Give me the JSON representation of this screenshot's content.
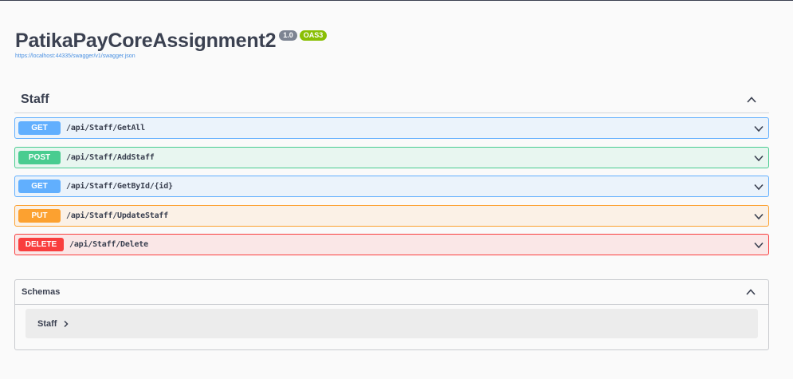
{
  "info": {
    "title": "PatikaPayCoreAssignment2",
    "version": "1.0",
    "oas": "OAS3",
    "url": "https://localhost:44335/swagger/v1/swagger.json"
  },
  "tag": {
    "name": "Staff"
  },
  "operations": [
    {
      "method": "GET",
      "path": "/api/Staff/GetAll"
    },
    {
      "method": "POST",
      "path": "/api/Staff/AddStaff"
    },
    {
      "method": "GET",
      "path": "/api/Staff/GetById/{id}"
    },
    {
      "method": "PUT",
      "path": "/api/Staff/UpdateStaff"
    },
    {
      "method": "DELETE",
      "path": "/api/Staff/Delete"
    }
  ],
  "schemas": {
    "title": "Schemas",
    "items": [
      "Staff"
    ]
  },
  "icons": {
    "collapse": "chevron-up-icon",
    "expand": "chevron-down-icon",
    "schema_expand": "chevron-right-icon"
  }
}
